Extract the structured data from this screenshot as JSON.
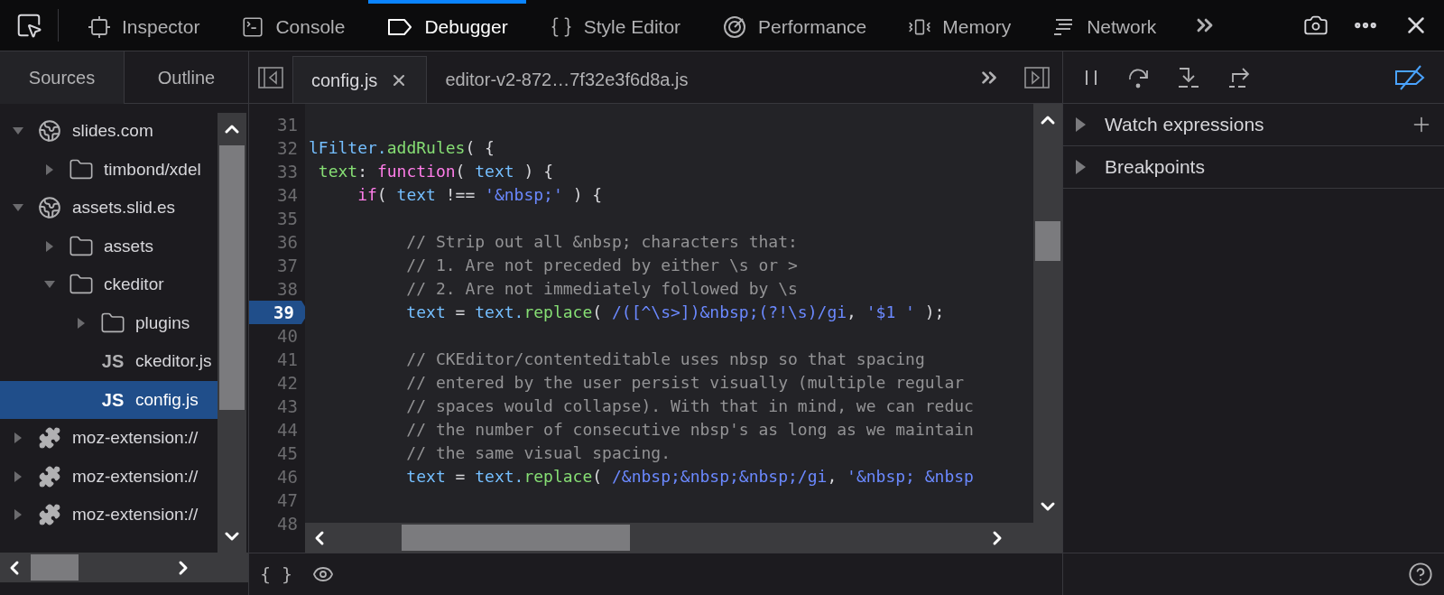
{
  "toolbar": {
    "tabs": [
      {
        "label": "Inspector",
        "selected": false
      },
      {
        "label": "Console",
        "selected": false
      },
      {
        "label": "Debugger",
        "selected": true
      },
      {
        "label": "Style Editor",
        "selected": false
      },
      {
        "label": "Performance",
        "selected": false
      },
      {
        "label": "Memory",
        "selected": false
      },
      {
        "label": "Network",
        "selected": false
      }
    ]
  },
  "sidebar": {
    "tabs": [
      {
        "label": "Sources",
        "selected": true
      },
      {
        "label": "Outline",
        "selected": false
      }
    ],
    "tree": [
      {
        "kind": "domain",
        "label": "slides.com",
        "expanded": true,
        "selected": false,
        "children": [
          {
            "kind": "folder",
            "label": "timbond/xdel",
            "expanded": false,
            "selected": false
          }
        ]
      },
      {
        "kind": "domain",
        "label": "assets.slid.es",
        "expanded": true,
        "selected": false,
        "children": [
          {
            "kind": "folder",
            "label": "assets",
            "expanded": false,
            "selected": false
          },
          {
            "kind": "folder",
            "label": "ckeditor",
            "expanded": true,
            "selected": false,
            "children": [
              {
                "kind": "folder",
                "label": "plugins",
                "expanded": false,
                "selected": false
              },
              {
                "kind": "file",
                "badge": "JS",
                "label": "ckeditor.js",
                "selected": false
              },
              {
                "kind": "file",
                "badge": "JS",
                "label": "config.js",
                "selected": true
              }
            ]
          }
        ]
      },
      {
        "kind": "extension",
        "label": "moz-extension://",
        "expanded": false,
        "selected": false
      },
      {
        "kind": "extension",
        "label": "moz-extension://",
        "expanded": false,
        "selected": false
      },
      {
        "kind": "extension",
        "label": "moz-extension://",
        "expanded": false,
        "selected": false
      }
    ]
  },
  "editor": {
    "tabs": [
      {
        "label": "config.js",
        "selected": true,
        "closable": true
      },
      {
        "label": "editor-v2-872…7f32e3f6d8a.js",
        "selected": false,
        "closable": false
      }
    ],
    "lines": [
      {
        "number": "31",
        "breakpoint": false
      },
      {
        "number": "32",
        "breakpoint": false,
        "tokens": [
          {
            "kind": "var",
            "text": "lFilter."
          },
          {
            "kind": "func",
            "text": "addRules"
          },
          {
            "kind": "plain",
            "text": "( {"
          }
        ]
      },
      {
        "number": "33",
        "breakpoint": false,
        "tokens": [
          {
            "kind": "func",
            "text": " text"
          },
          {
            "kind": "plain",
            "text": ": "
          },
          {
            "kind": "keyword",
            "text": "function"
          },
          {
            "kind": "plain",
            "text": "( "
          },
          {
            "kind": "var",
            "text": "text"
          },
          {
            "kind": "plain",
            "text": " ) {"
          }
        ]
      },
      {
        "number": "34",
        "breakpoint": false,
        "tokens": [
          {
            "kind": "keyword",
            "text": "     if"
          },
          {
            "kind": "plain",
            "text": "( "
          },
          {
            "kind": "var",
            "text": "text"
          },
          {
            "kind": "plain",
            "text": " !== "
          },
          {
            "kind": "string",
            "text": "'&nbsp;'"
          },
          {
            "kind": "plain",
            "text": " ) {"
          }
        ]
      },
      {
        "number": "35",
        "breakpoint": false
      },
      {
        "number": "36",
        "breakpoint": false,
        "tokens": [
          {
            "kind": "comment",
            "text": "          // Strip out all &nbsp; characters that:"
          }
        ]
      },
      {
        "number": "37",
        "breakpoint": false,
        "tokens": [
          {
            "kind": "comment",
            "text": "          // 1. Are not preceded by either \\s or >"
          }
        ]
      },
      {
        "number": "38",
        "breakpoint": false,
        "tokens": [
          {
            "kind": "comment",
            "text": "          // 2. Are not immediately followed by \\s"
          }
        ]
      },
      {
        "number": "39",
        "breakpoint": true,
        "tokens": [
          {
            "kind": "var",
            "text": "          text"
          },
          {
            "kind": "plain",
            "text": " = "
          },
          {
            "kind": "var",
            "text": "text."
          },
          {
            "kind": "func",
            "text": "replace"
          },
          {
            "kind": "plain",
            "text": "( "
          },
          {
            "kind": "string",
            "text": "/([^\\s>])&nbsp;(?!\\s)/gi"
          },
          {
            "kind": "plain",
            "text": ", "
          },
          {
            "kind": "string",
            "text": "'$1 '"
          },
          {
            "kind": "plain",
            "text": " );"
          }
        ]
      },
      {
        "number": "40",
        "breakpoint": false
      },
      {
        "number": "41",
        "breakpoint": false,
        "tokens": [
          {
            "kind": "comment",
            "text": "          // CKEditor/contenteditable uses nbsp so that spacing"
          }
        ]
      },
      {
        "number": "42",
        "breakpoint": false,
        "tokens": [
          {
            "kind": "comment",
            "text": "          // entered by the user persist visually (multiple regular"
          }
        ]
      },
      {
        "number": "43",
        "breakpoint": false,
        "tokens": [
          {
            "kind": "comment",
            "text": "          // spaces would collapse). With that in mind, we can reduc"
          }
        ]
      },
      {
        "number": "44",
        "breakpoint": false,
        "tokens": [
          {
            "kind": "comment",
            "text": "          // the number of consecutive nbsp's as long as we maintain"
          }
        ]
      },
      {
        "number": "45",
        "breakpoint": false,
        "tokens": [
          {
            "kind": "comment",
            "text": "          // the same visual spacing."
          }
        ]
      },
      {
        "number": "46",
        "breakpoint": false,
        "tokens": [
          {
            "kind": "var",
            "text": "          text"
          },
          {
            "kind": "plain",
            "text": " = "
          },
          {
            "kind": "var",
            "text": "text."
          },
          {
            "kind": "func",
            "text": "replace"
          },
          {
            "kind": "plain",
            "text": "( "
          },
          {
            "kind": "string",
            "text": "/&nbsp;&nbsp;&nbsp;/gi"
          },
          {
            "kind": "plain",
            "text": ", "
          },
          {
            "kind": "string",
            "text": "'&nbsp; &nbsp"
          }
        ]
      },
      {
        "number": "47",
        "breakpoint": false
      },
      {
        "number": "48",
        "breakpoint": false
      }
    ],
    "footer": {
      "pretty_print": "{ }"
    }
  },
  "debugger": {
    "sections": [
      {
        "label": "Watch expressions",
        "expanded": false,
        "addable": true
      },
      {
        "label": "Breakpoints",
        "expanded": false,
        "addable": false
      }
    ]
  }
}
